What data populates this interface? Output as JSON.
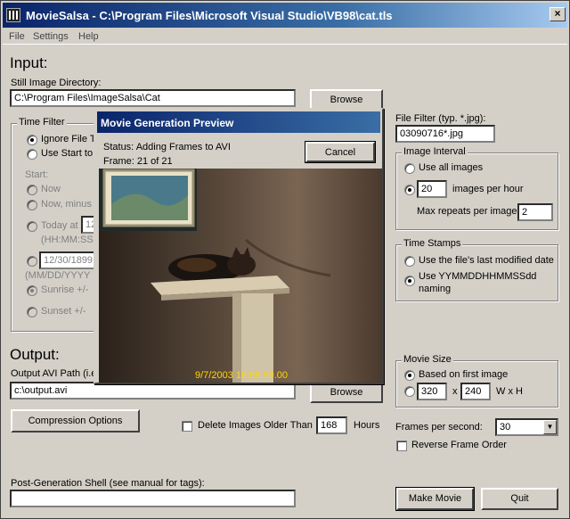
{
  "window": {
    "title": "MovieSalsa - C:\\Program Files\\Microsoft Visual Studio\\VB98\\cat.tls"
  },
  "menu": [
    "File",
    "Settings",
    "Help"
  ],
  "input": {
    "heading": "Input:",
    "still_dir_label": "Still Image Directory:",
    "still_dir_value": "C:\\Program Files\\ImageSalsa\\Cat",
    "browse_label": "Browse"
  },
  "time_filter": {
    "title": "Time Filter",
    "ignore_label": "Ignore File T",
    "use_start_label": "Use Start to",
    "start_label": "Start:",
    "now_label": "Now",
    "now_minus_label": "Now, minus",
    "today_label": "Today at",
    "today_value": "12",
    "time_format": "(HH:MM:SS",
    "date_value": "12/30/1899",
    "date_format": "(MM/DD/YYYY",
    "sunrise_label": "Sunrise +/-",
    "sunset_label": "Sunset +/-"
  },
  "file_filter": {
    "label": "File Filter (typ. *.jpg):",
    "value": "03090716*.jpg"
  },
  "image_interval": {
    "title": "Image Interval",
    "use_all_label": "Use all images",
    "per_hour_value": "20",
    "per_hour_label": "images per hour",
    "max_repeats_label": "Max repeats per image:",
    "max_repeats_value": "2"
  },
  "time_stamps": {
    "title": "Time Stamps",
    "last_modified_label": "Use the file's last modified date",
    "naming_label_1": "Use YYMMDDHHMMSSdd",
    "naming_label_2": "naming"
  },
  "output": {
    "heading": "Output:",
    "path_label": "Output AVI Path (i.e",
    "path_value": "c:\\output.avi",
    "browse_label": "Browse",
    "compression_label": "Compression Options",
    "delete_label": "Delete Images Older Than",
    "delete_value": "168",
    "hours_label": "Hours"
  },
  "movie_size": {
    "title": "Movie Size",
    "first_image_label": "Based on first image",
    "width_value": "320",
    "x_label": "x",
    "height_value": "240",
    "wh_label": "W x H"
  },
  "fps": {
    "label": "Frames per second:",
    "value": "30"
  },
  "reverse_label": "Reverse Frame Order",
  "post_shell_label": "Post-Generation Shell (see manual for tags):",
  "post_shell_value": "",
  "make_movie_label": "Make Movie",
  "quit_label": "Quit",
  "dialog": {
    "title": "Movie Generation Preview",
    "status": "Status: Adding Frames to AVI",
    "frame": "Frame: 21 of 21",
    "cancel_label": "Cancel",
    "timestamp": "9/7/2003 16:59:59.00"
  },
  "colors": {
    "titlebar": "#0a246a",
    "face": "#d4d0c8",
    "timestamp": "#ffd700"
  }
}
